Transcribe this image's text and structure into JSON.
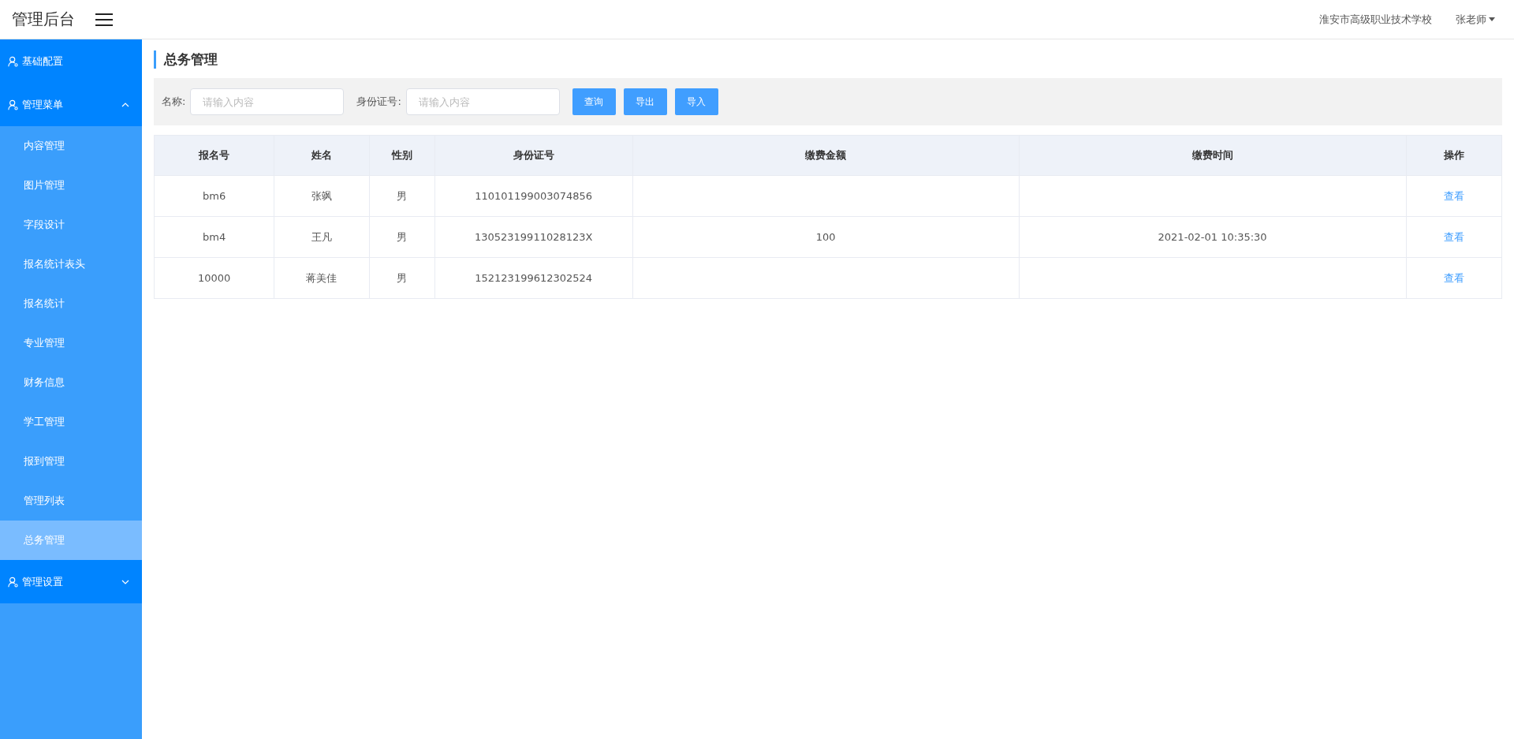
{
  "header": {
    "title": "管理后台",
    "school": "淮安市高级职业技术学校",
    "user": "张老师"
  },
  "sidebar": {
    "groups": [
      {
        "kind": "link",
        "label": "基础配置"
      },
      {
        "kind": "submenu",
        "label": "管理菜单",
        "expanded": true,
        "children": [
          {
            "label": "内容管理",
            "selected": false
          },
          {
            "label": "图片管理",
            "selected": false
          },
          {
            "label": "字段设计",
            "selected": false
          },
          {
            "label": "报名统计表头",
            "selected": false
          },
          {
            "label": "报名统计",
            "selected": false
          },
          {
            "label": "专业管理",
            "selected": false
          },
          {
            "label": "财务信息",
            "selected": false
          },
          {
            "label": "学工管理",
            "selected": false
          },
          {
            "label": "报到管理",
            "selected": false
          },
          {
            "label": "管理列表",
            "selected": false
          },
          {
            "label": "总务管理",
            "selected": true
          }
        ]
      },
      {
        "kind": "submenu",
        "label": "管理设置",
        "expanded": false
      }
    ]
  },
  "page_title": "总务管理",
  "filters": [
    {
      "label": "名称:",
      "placeholder": "请输入内容"
    },
    {
      "label": "身份证号:",
      "placeholder": "请输入内容"
    }
  ],
  "buttons": [
    "查询",
    "导出",
    "导入"
  ],
  "table": {
    "columns": [
      "报名号",
      "姓名",
      "性别",
      "身份证号",
      "缴费金额",
      "缴费时间",
      "操作"
    ],
    "rows": [
      {
        "cells": [
          "bm6",
          "张飒",
          "男",
          "110101199003074856",
          "",
          ""
        ],
        "action": "查看"
      },
      {
        "cells": [
          "bm4",
          "王凡",
          "男",
          "13052319911028123X",
          "100",
          "2021-02-01 10:35:30"
        ],
        "action": "查看"
      },
      {
        "cells": [
          "10000",
          "蒋美佳",
          "男",
          "152123199612302524",
          "",
          ""
        ],
        "action": "查看"
      }
    ]
  }
}
